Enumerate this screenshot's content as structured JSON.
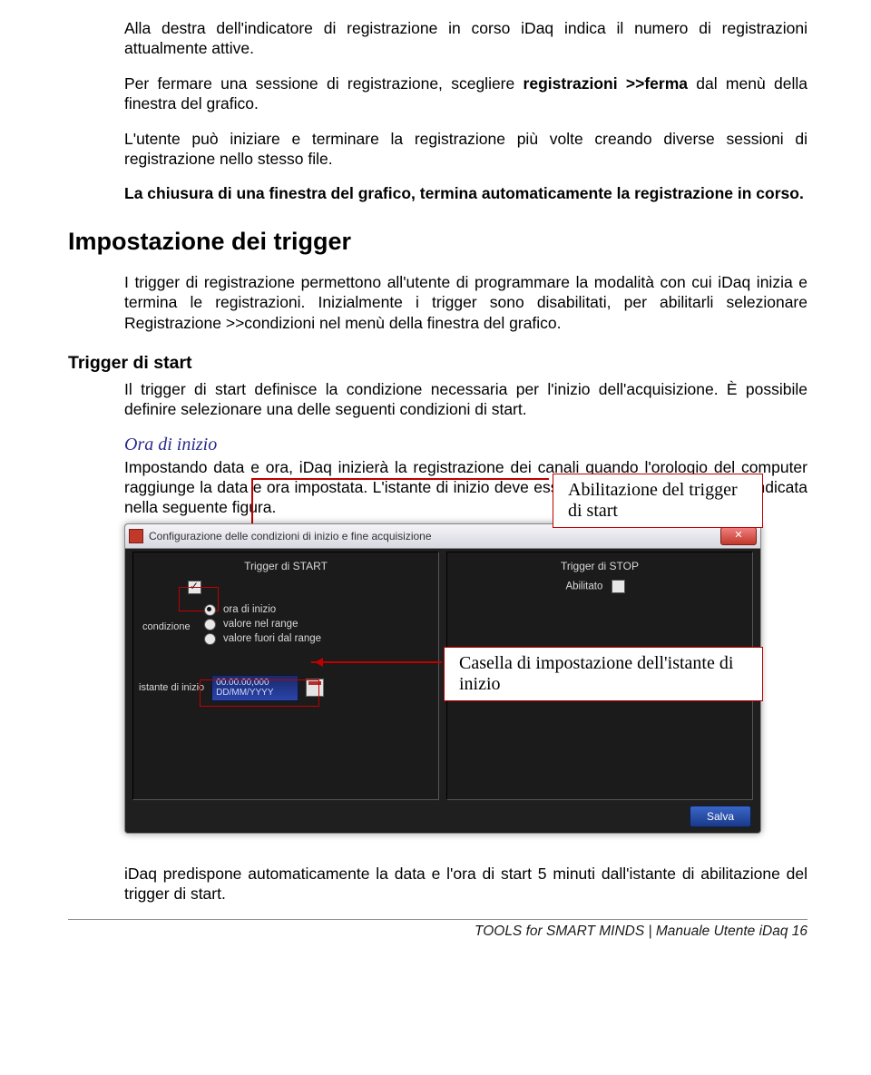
{
  "paras": {
    "p1": "Alla destra dell'indicatore di registrazione in corso iDaq indica il numero di registrazioni attualmente attive.",
    "p2a": "Per fermare una sessione di registrazione, scegliere ",
    "p2b": "registrazioni >>ferma",
    "p2c": " dal menù della finestra del grafico.",
    "p3": "L'utente può iniziare e terminare la registrazione più volte creando diverse sessioni di registrazione nello stesso file.",
    "p4": "La chiusura di una finestra del grafico, termina automaticamente la registrazione in corso.",
    "p5": "I trigger di registrazione permettono all'utente di programmare la modalità con cui iDaq inizia e termina le registrazioni. Inizialmente i trigger sono disabilitati, per abilitarli selezionare Registrazione >>condizioni nel menù della finestra del grafico.",
    "p6": "Il trigger di start definisce la condizione necessaria per l'inizio dell'acquisizione. È possibile definire selezionare una delle seguenti condizioni di start.",
    "p7": "Impostando data e ora, iDaq inizierà la registrazione dei canali quando l'orologio del computer raggiunge la data e ora impostata. L'istante di inizio deve essere impostato nella casella indicata nella seguente figura.",
    "p8": "iDaq predispone automaticamente la data e l'ora di start 5 minuti dall'istante di abilitazione del trigger di start."
  },
  "headings": {
    "h2": "Impostazione dei trigger",
    "h3": "Trigger di start",
    "ora": "Ora di inizio"
  },
  "callouts": {
    "c1": "Abilitazione del trigger di start",
    "c2": "Casella di impostazione dell'istante di inizio"
  },
  "dialog": {
    "title": "Configurazione delle condizioni di inizio e fine acquisizione",
    "start_header": "Trigger di START",
    "stop_header": "Trigger di STOP",
    "abilitato": "Abilitato",
    "condizione": "condizione",
    "radio1": "ora di inizio",
    "radio2": "valore nel range",
    "radio3": "valore fuori dal range",
    "istante_label": "istante di inizio",
    "istante_value": "00.00.00,000\nDD/MM/YYYY",
    "salva": "Salva"
  },
  "footer": {
    "text": "TOOLS for SMART MINDS | Manuale Utente iDaq  16"
  }
}
